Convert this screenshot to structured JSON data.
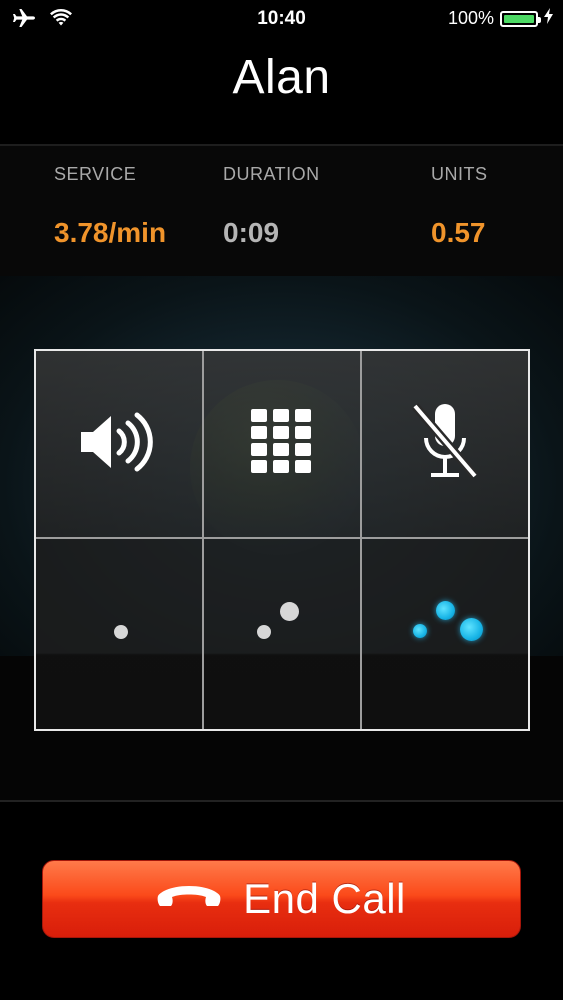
{
  "status_bar": {
    "time": "10:40",
    "battery_percent_label": "100%",
    "battery_level": 1.0,
    "icons": [
      "airplane-icon",
      "wifi-icon",
      "battery-icon",
      "charging-bolt-icon"
    ],
    "battery_color": "#4cd964"
  },
  "call": {
    "caller_name": "Alan"
  },
  "stats": {
    "service_label": "SERVICE",
    "service_value": "3.78/min",
    "duration_label": "DURATION",
    "duration_value": "0:09",
    "units_label": "UNITS",
    "units_value": "0.57",
    "accent_color": "#f0942b",
    "neutral_value_color": "#b5b5b5"
  },
  "controls": {
    "icons": [
      "speaker-icon",
      "keypad-icon",
      "mute-icon",
      "quality-1-icon",
      "quality-2-icon",
      "quality-3-icon"
    ],
    "active_dot_color": "#17b4e6"
  },
  "end_call": {
    "label": "End Call",
    "icon": "phone-hangup-icon",
    "color": "#f0401a"
  }
}
